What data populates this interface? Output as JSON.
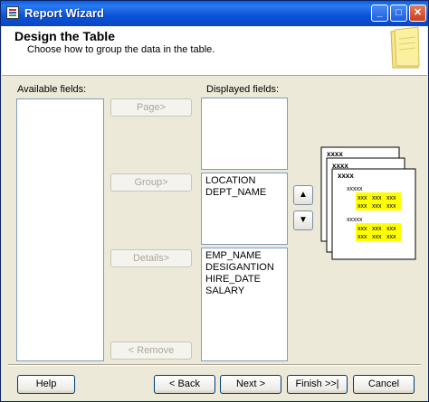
{
  "window": {
    "title": "Report Wizard",
    "min_glyph": "_",
    "max_glyph": "□",
    "close_glyph": "✕"
  },
  "header": {
    "title": "Design the Table",
    "subtitle": "Choose how to group the data in the table."
  },
  "available": {
    "label": "Available fields:",
    "items": []
  },
  "displayed": {
    "label": "Displayed fields:",
    "page_items": [],
    "group_items": [
      "LOCATION",
      "DEPT_NAME"
    ],
    "detail_items": [
      "EMP_NAME",
      "DESIGANTION",
      "HIRE_DATE",
      "SALARY"
    ]
  },
  "buttons": {
    "page": "Page>",
    "group": "Group>",
    "details": "Details>",
    "remove": "< Remove",
    "up_glyph": "▲",
    "down_glyph": "▼"
  },
  "preview": {
    "header_text": "xxxx",
    "row_label": "xxxxx",
    "cell_text": "xxx",
    "highlight_color": "#ffff00"
  },
  "footer": {
    "help": "Help",
    "back": "< Back",
    "next": "Next >",
    "finish": "Finish >>|",
    "cancel": "Cancel"
  }
}
